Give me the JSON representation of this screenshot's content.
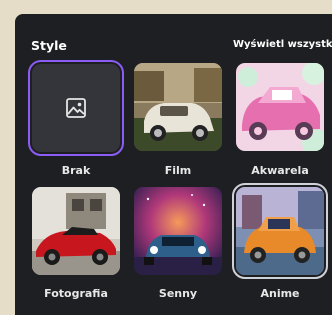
{
  "header": {
    "title": "Style",
    "view_all": "Wyświetl wszystko"
  },
  "styles": [
    {
      "label": "Brak",
      "selected": true,
      "icon": "image-icon"
    },
    {
      "label": "Film",
      "selected": false
    },
    {
      "label": "Akwarela",
      "selected": false
    },
    {
      "label": "Fotografia",
      "selected": false
    },
    {
      "label": "Senny",
      "selected": false
    },
    {
      "label": "Anime",
      "selected": false
    }
  ],
  "colors": {
    "panel_bg": "#1e1f22",
    "selection_accent": "#8b5cf6"
  }
}
